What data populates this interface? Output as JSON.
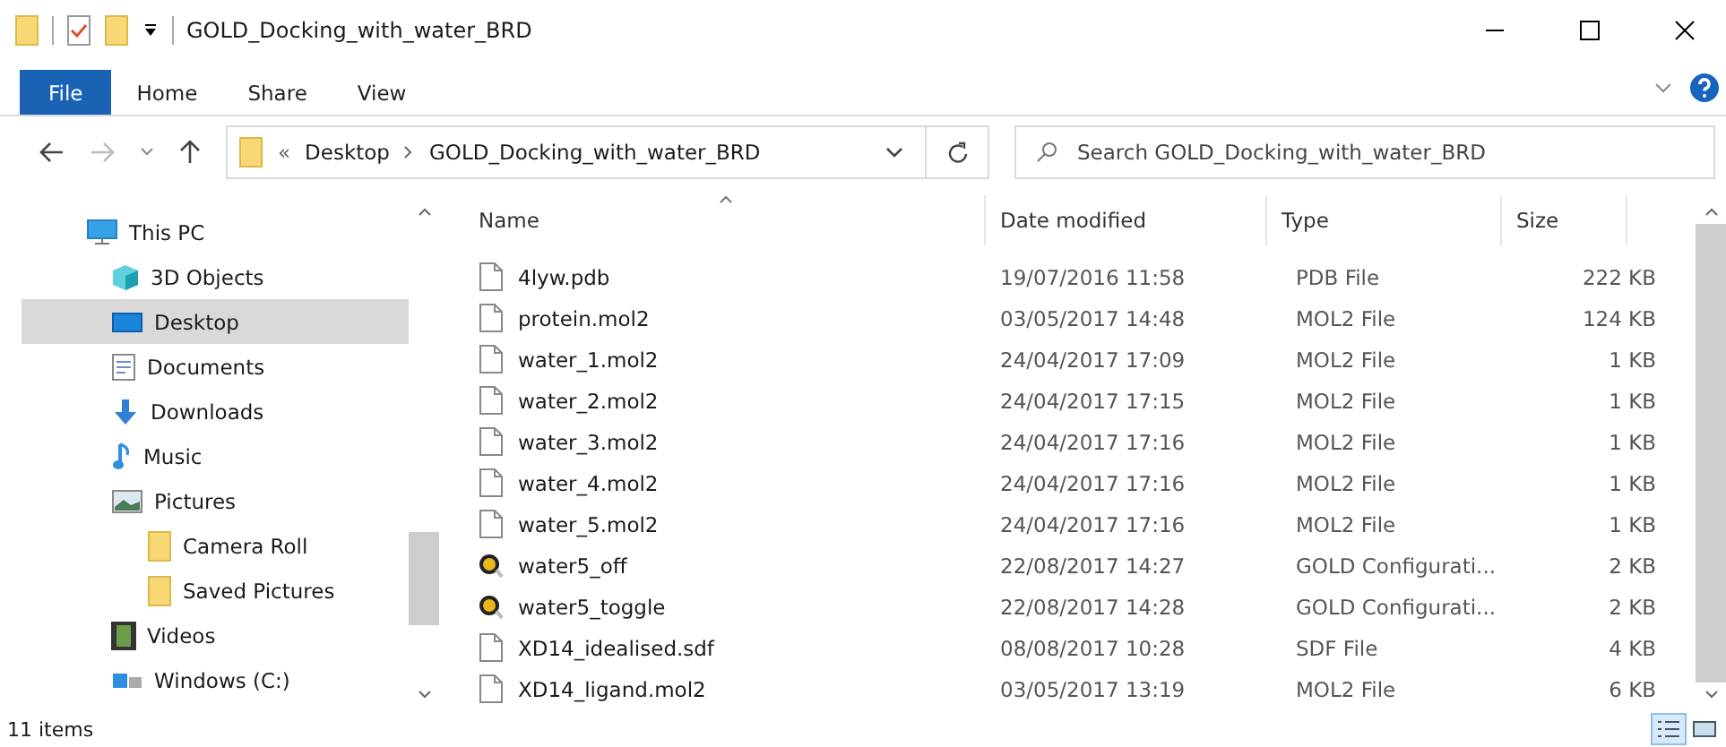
{
  "window": {
    "title": "GOLD_Docking_with_water_BRD"
  },
  "ribbon_tabs": [
    {
      "label": "File",
      "selected": true
    },
    {
      "label": "Home",
      "selected": false
    },
    {
      "label": "Share",
      "selected": false
    },
    {
      "label": "View",
      "selected": false
    }
  ],
  "address_bar": {
    "overflow": "«",
    "breadcrumbs": [
      "Desktop",
      "GOLD_Docking_with_water_BRD"
    ]
  },
  "search": {
    "placeholder": "Search GOLD_Docking_with_water_BRD"
  },
  "navigation": [
    {
      "label": "This PC",
      "kind": "pc",
      "selected": false,
      "children": [
        {
          "label": "3D Objects",
          "kind": "cube",
          "selected": false
        },
        {
          "label": "Desktop",
          "kind": "desktop",
          "selected": true
        },
        {
          "label": "Documents",
          "kind": "documents",
          "selected": false
        },
        {
          "label": "Downloads",
          "kind": "download",
          "selected": false
        },
        {
          "label": "Music",
          "kind": "music",
          "selected": false
        },
        {
          "label": "Pictures",
          "kind": "pictures",
          "selected": false,
          "children": [
            {
              "label": "Camera Roll",
              "kind": "folder",
              "selected": false
            },
            {
              "label": "Saved Pictures",
              "kind": "folder",
              "selected": false
            }
          ]
        },
        {
          "label": "Videos",
          "kind": "videos",
          "selected": false
        },
        {
          "label": "Windows (C:)",
          "kind": "drive",
          "selected": false
        }
      ]
    }
  ],
  "table": {
    "columns": [
      "Name",
      "Date modified",
      "Type",
      "Size"
    ],
    "rows": [
      {
        "kind": "file",
        "name": "4lyw.pdb",
        "date": "19/07/2016 11:58",
        "type": "PDB File",
        "size": "222 KB"
      },
      {
        "kind": "file",
        "name": "protein.mol2",
        "date": "03/05/2017 14:48",
        "type": "MOL2 File",
        "size": "124 KB"
      },
      {
        "kind": "file",
        "name": "water_1.mol2",
        "date": "24/04/2017 17:09",
        "type": "MOL2 File",
        "size": "1 KB"
      },
      {
        "kind": "file",
        "name": "water_2.mol2",
        "date": "24/04/2017 17:15",
        "type": "MOL2 File",
        "size": "1 KB"
      },
      {
        "kind": "file",
        "name": "water_3.mol2",
        "date": "24/04/2017 17:16",
        "type": "MOL2 File",
        "size": "1 KB"
      },
      {
        "kind": "file",
        "name": "water_4.mol2",
        "date": "24/04/2017 17:16",
        "type": "MOL2 File",
        "size": "1 KB"
      },
      {
        "kind": "file",
        "name": "water_5.mol2",
        "date": "24/04/2017 17:16",
        "type": "MOL2 File",
        "size": "1 KB"
      },
      {
        "kind": "gold",
        "name": "water5_off",
        "date": "22/08/2017 14:27",
        "type": "GOLD Configurati...",
        "size": "2 KB"
      },
      {
        "kind": "gold",
        "name": "water5_toggle",
        "date": "22/08/2017 14:28",
        "type": "GOLD Configurati...",
        "size": "2 KB"
      },
      {
        "kind": "file",
        "name": "XD14_idealised.sdf",
        "date": "08/08/2017 10:28",
        "type": "SDF File",
        "size": "4 KB"
      },
      {
        "kind": "file",
        "name": "XD14_ligand.mol2",
        "date": "03/05/2017 13:19",
        "type": "MOL2 File",
        "size": "6 KB"
      }
    ]
  },
  "status_bar": {
    "item_count": "11 items"
  }
}
